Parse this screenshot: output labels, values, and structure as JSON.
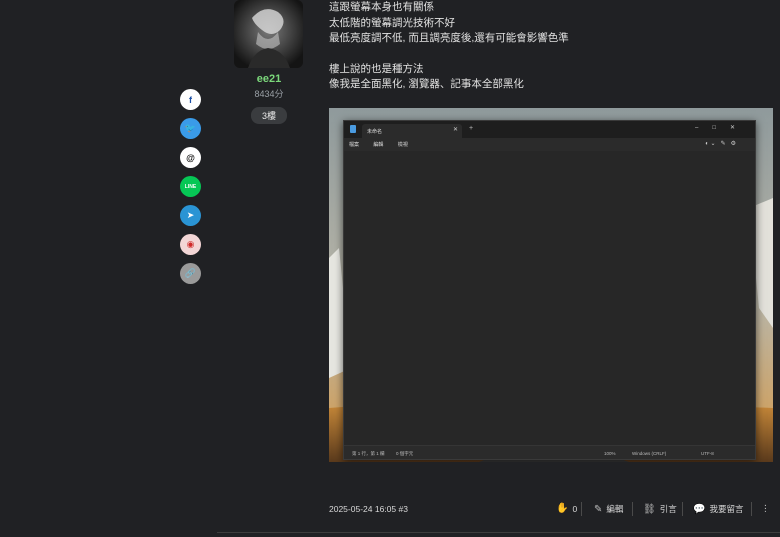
{
  "share": {
    "buttons": [
      {
        "name": "facebook",
        "glyph": "f"
      },
      {
        "name": "twitter",
        "glyph": "🐦"
      },
      {
        "name": "threads",
        "glyph": "@"
      },
      {
        "name": "line",
        "glyph": "LINE"
      },
      {
        "name": "telegram",
        "glyph": "➤"
      },
      {
        "name": "weibo",
        "glyph": "◉"
      },
      {
        "name": "copy-link",
        "glyph": "🔗"
      }
    ]
  },
  "user": {
    "name": "ee21",
    "score": "8434分",
    "floor": "3樓"
  },
  "post": {
    "lines": [
      "這跟螢幕本身也有關係",
      "太低階的螢幕調光技術不好",
      "最低亮度調不低, 而且調亮度後,還有可能會影響色準",
      "",
      "樓上說的也是種方法",
      "像我是全面黑化, 瀏覽器、記事本全部黑化"
    ]
  },
  "notepad": {
    "tab_title": "未命名",
    "menu": [
      "檔案",
      "編輯",
      "檢視"
    ],
    "status": {
      "position": "第 1 行，第 1 欄",
      "chars": "0 個字元",
      "zoom": "100%",
      "eol": "Windows (CRLF)",
      "encoding": "UTF-8"
    }
  },
  "footer": {
    "date": "2025-05-24 16:05 #3",
    "like_count": "0",
    "edit_label": "編輯",
    "quote_label": "引言",
    "reply_label": "我要留言",
    "more_label": "⋮"
  },
  "colors": {
    "background": "#202124",
    "username": "#7bd87b"
  }
}
